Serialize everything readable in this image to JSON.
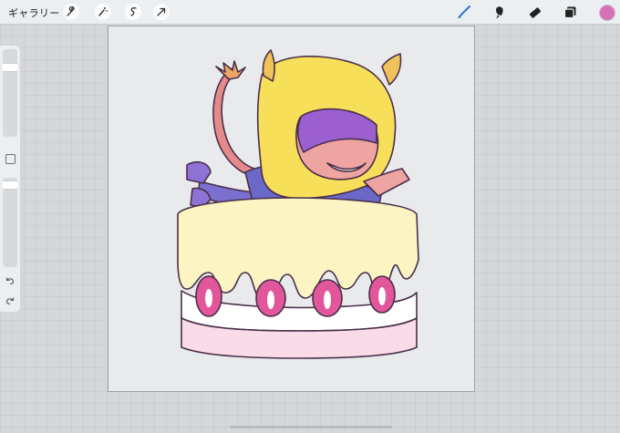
{
  "toolbar": {
    "gallery_label": "ギャラリー",
    "left_tools": [
      "wrench-icon",
      "magic-wand-icon",
      "selection-icon",
      "transform-arrow-icon"
    ],
    "right_tools": [
      "brush-icon",
      "smudge-icon",
      "eraser-icon",
      "layers-icon"
    ],
    "active_tool": "brush-icon",
    "accent_color": "#2e6fd9",
    "current_color": "#d971b8"
  },
  "sidebar": {
    "brush_size_level": 0.82,
    "opacity_level": 0.0,
    "undo_icon": "undo-icon",
    "redo_icon": "redo-icon"
  },
  "artwork": {
    "palette": {
      "hood": "#f7df5a",
      "mask": "#9b5fcf",
      "skin": "#eea4a0",
      "tail": "#e58a8a",
      "cake_icing": "#fcf4c3",
      "cake_body": "#f9dce8",
      "strawberry": "#e2579c",
      "outline": "#4a2f4a"
    }
  }
}
